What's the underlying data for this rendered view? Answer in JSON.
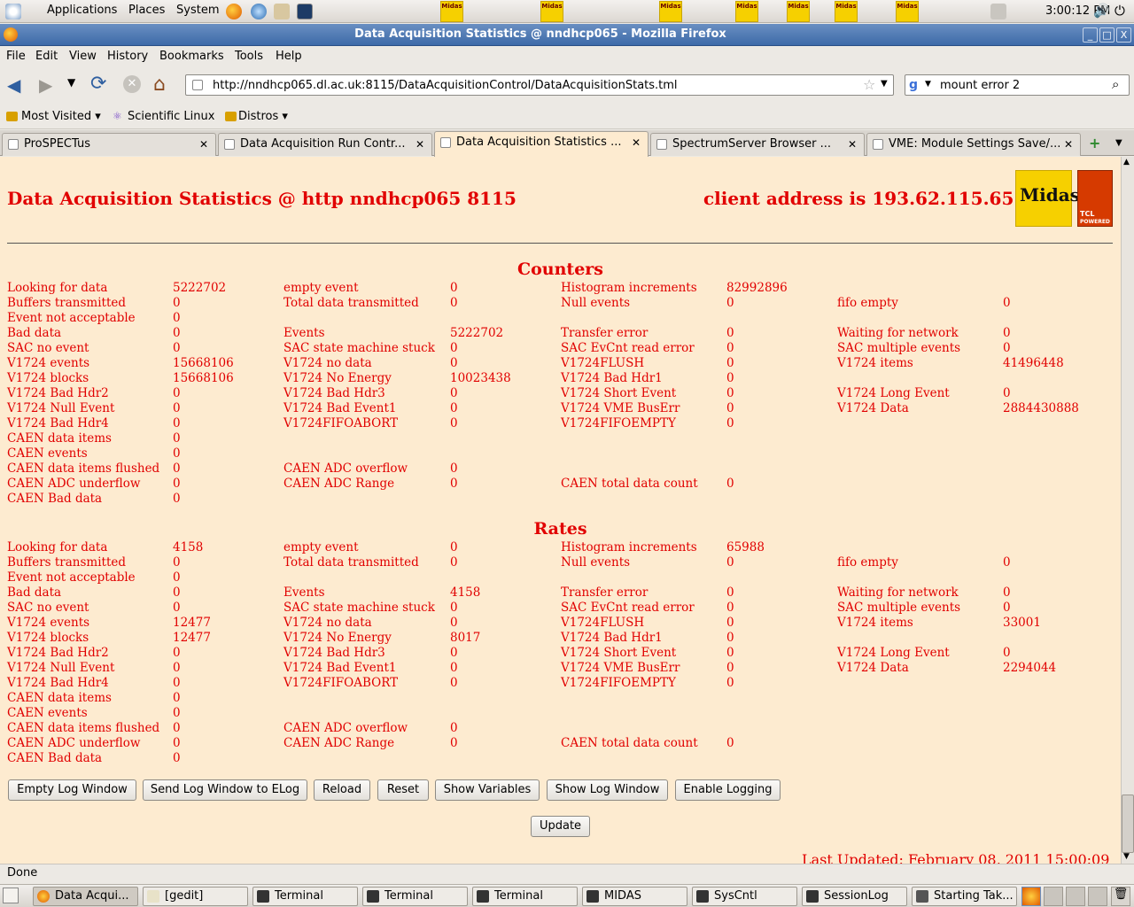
{
  "panel": {
    "applications": "Applications",
    "places": "Places",
    "system": "System",
    "clock": "3:00:12 PM",
    "applet_label": "Midas"
  },
  "window": {
    "title": "Data Acquisition Statistics @ nndhcp065 - Mozilla Firefox",
    "min": "_",
    "max": "□",
    "close": "X"
  },
  "menu": [
    "File",
    "Edit",
    "View",
    "History",
    "Bookmarks",
    "Tools",
    "Help"
  ],
  "nav": {
    "url": "http://nndhcp065.dl.ac.uk:8115/DataAcquisitionControl/DataAcquisitionStats.tml",
    "search": "mount error 2"
  },
  "bookmarks": {
    "most_visited": "Most Visited ▾",
    "scientific_linux": "Scientific Linux",
    "distros": "Distros ▾"
  },
  "tabs": [
    {
      "label": "ProSPECTus"
    },
    {
      "label": "Data Acquisition Run Contr..."
    },
    {
      "label": "Data Acquisition Statistics ..."
    },
    {
      "label": "SpectrumServer Browser ..."
    },
    {
      "label": "VME: Module Settings Save/..."
    }
  ],
  "page": {
    "title": "Data Acquisition Statistics @ http nndhcp065 8115",
    "client": "client address is 193.62.115.65",
    "logo_midas": "Midas",
    "logo_tcl": "TCL",
    "logo_powered": "POWERED",
    "counters_title": "Counters",
    "rates_title": "Rates",
    "last_updated": "Last Updated: February 08, 2011 15:00:09"
  },
  "counters": [
    [
      [
        "Looking for data",
        "5222702"
      ],
      [
        "empty event",
        "0"
      ],
      [
        "Histogram increments",
        "82992896"
      ],
      [
        "",
        ""
      ]
    ],
    [
      [
        "Buffers transmitted",
        "0"
      ],
      [
        "Total data transmitted",
        "0"
      ],
      [
        "Null events",
        "0"
      ],
      [
        "fifo empty",
        "0"
      ]
    ],
    [
      [
        "Event not acceptable",
        "0"
      ],
      [
        "",
        ""
      ],
      [
        "",
        ""
      ],
      [
        "",
        ""
      ]
    ],
    [
      [
        "Bad data",
        "0"
      ],
      [
        "Events",
        "5222702"
      ],
      [
        "Transfer error",
        "0"
      ],
      [
        "Waiting for network",
        "0"
      ]
    ],
    [
      [
        "SAC no event",
        "0"
      ],
      [
        "SAC state machine stuck",
        "0"
      ],
      [
        "SAC EvCnt read error",
        "0"
      ],
      [
        "SAC multiple events",
        "0"
      ]
    ],
    [
      [
        "V1724 events",
        "15668106"
      ],
      [
        "V1724 no data",
        "0"
      ],
      [
        "V1724FLUSH",
        "0"
      ],
      [
        "V1724 items",
        "41496448"
      ]
    ],
    [
      [
        "V1724 blocks",
        "15668106"
      ],
      [
        "V1724 No Energy",
        "10023438"
      ],
      [
        "V1724 Bad Hdr1",
        "0"
      ],
      [
        "",
        ""
      ]
    ],
    [
      [
        "V1724 Bad Hdr2",
        "0"
      ],
      [
        "V1724 Bad Hdr3",
        "0"
      ],
      [
        "V1724 Short Event",
        "0"
      ],
      [
        "V1724 Long Event",
        "0"
      ]
    ],
    [
      [
        "V1724 Null Event",
        "0"
      ],
      [
        "V1724 Bad Event1",
        "0"
      ],
      [
        "V1724 VME BusErr",
        "0"
      ],
      [
        "V1724 Data",
        "2884430888"
      ]
    ],
    [
      [
        "V1724 Bad Hdr4",
        "0"
      ],
      [
        "V1724FIFOABORT",
        "0"
      ],
      [
        "V1724FIFOEMPTY",
        "0"
      ],
      [
        "",
        ""
      ]
    ],
    [
      [
        "CAEN data items",
        "0"
      ],
      [
        "",
        ""
      ],
      [
        "",
        ""
      ],
      [
        "",
        ""
      ]
    ],
    [
      [
        "CAEN events",
        "0"
      ],
      [
        "",
        ""
      ],
      [
        "",
        ""
      ],
      [
        "",
        ""
      ]
    ],
    [
      [
        "CAEN data items flushed",
        "0"
      ],
      [
        "CAEN ADC overflow",
        "0"
      ],
      [
        "",
        ""
      ],
      [
        "",
        ""
      ]
    ],
    [
      [
        "CAEN ADC underflow",
        "0"
      ],
      [
        "CAEN ADC Range",
        "0"
      ],
      [
        "CAEN total data count",
        "0"
      ],
      [
        "",
        ""
      ]
    ],
    [
      [
        "CAEN Bad data",
        "0"
      ],
      [
        "",
        ""
      ],
      [
        "",
        ""
      ],
      [
        "",
        ""
      ]
    ]
  ],
  "rates": [
    [
      [
        "Looking for data",
        "4158"
      ],
      [
        "empty event",
        "0"
      ],
      [
        "Histogram increments",
        "65988"
      ],
      [
        "",
        ""
      ]
    ],
    [
      [
        "Buffers transmitted",
        "0"
      ],
      [
        "Total data transmitted",
        "0"
      ],
      [
        "Null events",
        "0"
      ],
      [
        "fifo empty",
        "0"
      ]
    ],
    [
      [
        "Event not acceptable",
        "0"
      ],
      [
        "",
        ""
      ],
      [
        "",
        ""
      ],
      [
        "",
        ""
      ]
    ],
    [
      [
        "Bad data",
        "0"
      ],
      [
        "Events",
        "4158"
      ],
      [
        "Transfer error",
        "0"
      ],
      [
        "Waiting for network",
        "0"
      ]
    ],
    [
      [
        "SAC no event",
        "0"
      ],
      [
        "SAC state machine stuck",
        "0"
      ],
      [
        "SAC EvCnt read error",
        "0"
      ],
      [
        "SAC multiple events",
        "0"
      ]
    ],
    [
      [
        "V1724 events",
        "12477"
      ],
      [
        "V1724 no data",
        "0"
      ],
      [
        "V1724FLUSH",
        "0"
      ],
      [
        "V1724 items",
        "33001"
      ]
    ],
    [
      [
        "V1724 blocks",
        "12477"
      ],
      [
        "V1724 No Energy",
        "8017"
      ],
      [
        "V1724 Bad Hdr1",
        "0"
      ],
      [
        "",
        ""
      ]
    ],
    [
      [
        "V1724 Bad Hdr2",
        "0"
      ],
      [
        "V1724 Bad Hdr3",
        "0"
      ],
      [
        "V1724 Short Event",
        "0"
      ],
      [
        "V1724 Long Event",
        "0"
      ]
    ],
    [
      [
        "V1724 Null Event",
        "0"
      ],
      [
        "V1724 Bad Event1",
        "0"
      ],
      [
        "V1724 VME BusErr",
        "0"
      ],
      [
        "V1724 Data",
        "2294044"
      ]
    ],
    [
      [
        "V1724 Bad Hdr4",
        "0"
      ],
      [
        "V1724FIFOABORT",
        "0"
      ],
      [
        "V1724FIFOEMPTY",
        "0"
      ],
      [
        "",
        ""
      ]
    ],
    [
      [
        "CAEN data items",
        "0"
      ],
      [
        "",
        ""
      ],
      [
        "",
        ""
      ],
      [
        "",
        ""
      ]
    ],
    [
      [
        "CAEN events",
        "0"
      ],
      [
        "",
        ""
      ],
      [
        "",
        ""
      ],
      [
        "",
        ""
      ]
    ],
    [
      [
        "CAEN data items flushed",
        "0"
      ],
      [
        "CAEN ADC overflow",
        "0"
      ],
      [
        "",
        ""
      ],
      [
        "",
        ""
      ]
    ],
    [
      [
        "CAEN ADC underflow",
        "0"
      ],
      [
        "CAEN ADC Range",
        "0"
      ],
      [
        "CAEN total data count",
        "0"
      ],
      [
        "",
        ""
      ]
    ],
    [
      [
        "CAEN Bad data",
        "0"
      ],
      [
        "",
        ""
      ],
      [
        "",
        ""
      ],
      [
        "",
        ""
      ]
    ]
  ],
  "buttons": {
    "empty_log": "Empty Log Window",
    "send_log": "Send Log Window to ELog",
    "reload": "Reload",
    "reset": "Reset",
    "show_vars": "Show Variables",
    "show_log": "Show Log Window",
    "enable_logging": "Enable Logging",
    "update": "Update"
  },
  "status": "Done",
  "taskbar": [
    "Data Acqui...",
    "[gedit]",
    "Terminal",
    "Terminal",
    "Terminal",
    "MIDAS",
    "SysCntl",
    "SessionLog",
    "Starting Tak..."
  ],
  "colors": {
    "page_bg": "#fdebd0",
    "text_red": "#e10000",
    "titlebar": "#3d6aa8"
  }
}
